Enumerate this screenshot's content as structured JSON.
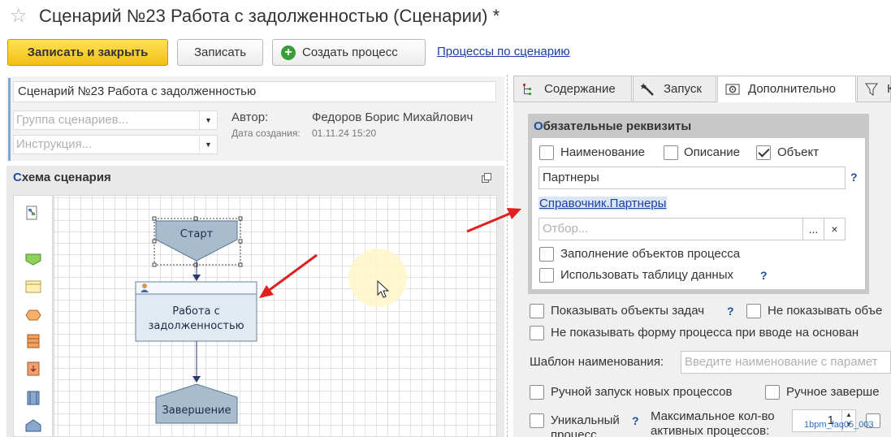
{
  "header": {
    "title": "Сценарий №23 Работа с задолженностью (Сценарии) *"
  },
  "toolbar": {
    "save_close": "Записать и закрыть",
    "save": "Записать",
    "create_process": "Создать процесс",
    "processes_link": "Процессы по сценарию"
  },
  "form": {
    "name_value": "Сценарий №23 Работа с задолженностью",
    "group_placeholder": "Группа сценариев...",
    "instruction_placeholder": "Инструкция...",
    "author_label": "Автор:",
    "author_value": "Федоров Борис Михайлович",
    "created_label": "Дата создания:",
    "created_value": "01.11.24 15:20"
  },
  "scheme": {
    "title_first": "С",
    "title_rest": "хема сценария",
    "nodes": {
      "start": "Старт",
      "task_line1": "Работа с",
      "task_line2": "задолженностью",
      "end": "Завершение"
    }
  },
  "tabs": [
    {
      "label": "Содержание",
      "icon": "tree-icon"
    },
    {
      "label": "Запуск",
      "icon": "wand-icon"
    },
    {
      "label": "Дополнительно",
      "icon": "settings-icon"
    }
  ],
  "requisites": {
    "title_first": "О",
    "title_rest": "бязательные реквизиты",
    "name_cb": "Наименование",
    "description_cb": "Описание",
    "object_cb": "Объект",
    "object_value": "Партнеры",
    "ref_link": "Справочник.Партнеры",
    "filter_placeholder": "Отбор...",
    "filter_select": "...",
    "filter_clear": "×",
    "fill_objects": "Заполнение объектов процесса",
    "use_table": "Использовать таблицу данных",
    "help": "?"
  },
  "options": {
    "show_task_objects": "Показывать объекты задач",
    "dont_show_objects": "Не показывать объе",
    "dont_show_form": "Не показывать форму процесса при вводе на основан",
    "name_template_label": "Шаблон наименования:",
    "name_template_placeholder": "Введите наименование с парамет",
    "manual_start": "Ручной запуск новых процессов",
    "manual_finish": "Ручное заверше",
    "unique_line1": "Уникальный",
    "unique_line2": "процесс",
    "max_active_line1": "Максимальное кол-во",
    "max_active_line2": "активных процессов:",
    "max_active_value": "1",
    "help": "?"
  },
  "watermark": "1bpm_faq05_003"
}
